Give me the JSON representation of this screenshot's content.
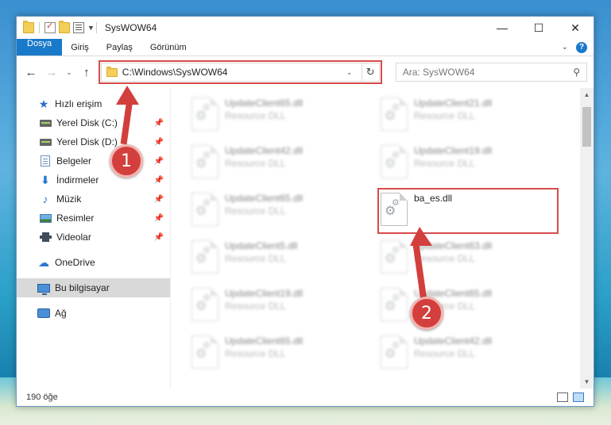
{
  "window": {
    "title": "SysWOW64",
    "controls": {
      "minimize": "—",
      "maximize": "☐",
      "close": "✕"
    }
  },
  "ribbon": {
    "tabs": [
      "Dosya",
      "Giriş",
      "Paylaş",
      "Görünüm"
    ],
    "help": "?"
  },
  "nav": {
    "address": "C:\\Windows\\SysWOW64",
    "search_placeholder": "Ara: SysWOW64"
  },
  "sidebar": {
    "quick_access": "Hızlı erişim",
    "items": [
      {
        "label": "Yerel Disk (C:)"
      },
      {
        "label": "Yerel Disk (D:)"
      },
      {
        "label": "Belgeler"
      },
      {
        "label": "İndirmeler"
      },
      {
        "label": "Müzik"
      },
      {
        "label": "Resimler"
      },
      {
        "label": "Videolar"
      }
    ],
    "onedrive": "OneDrive",
    "this_pc": "Bu bilgisayar",
    "network": "Ağ"
  },
  "files": [
    {
      "name": "UpdateClient65.dll",
      "type": "Resource DLL"
    },
    {
      "name": "UpdateClient21.dll",
      "type": "Resource DLL"
    },
    {
      "name": "UpdateClient42.dll",
      "type": "Resource DLL"
    },
    {
      "name": "UpdateClient19.dll",
      "type": "Resource DLL"
    },
    {
      "name": "UpdateClient65.dll",
      "type": "Resource DLL"
    },
    {
      "name": "ba_es.dll",
      "type": ""
    },
    {
      "name": "UpdateClient5.dll",
      "type": "Resource DLL"
    },
    {
      "name": "UpdateClient63.dll",
      "type": "Resource DLL"
    },
    {
      "name": "UpdateClient19.dll",
      "type": "Resource DLL"
    },
    {
      "name": "UpdateClient65.dll",
      "type": "Resource DLL"
    },
    {
      "name": "UpdateClient65.dll",
      "type": "Resource DLL"
    },
    {
      "name": "UpdateClient42.dll",
      "type": "Resource DLL"
    }
  ],
  "status": {
    "count": "190 öğe"
  },
  "annotations": {
    "step1": "1",
    "step2": "2"
  },
  "colors": {
    "accent": "#1979ca",
    "highlight": "#d84b4b"
  }
}
